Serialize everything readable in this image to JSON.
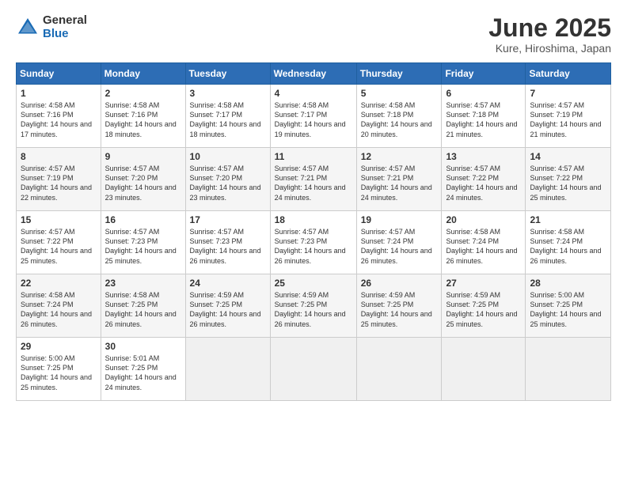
{
  "logo": {
    "general": "General",
    "blue": "Blue"
  },
  "title": "June 2025",
  "location": "Kure, Hiroshima, Japan",
  "days": [
    "Sunday",
    "Monday",
    "Tuesday",
    "Wednesday",
    "Thursday",
    "Friday",
    "Saturday"
  ],
  "weeks": [
    [
      {
        "day": "1",
        "sunrise": "4:58 AM",
        "sunset": "7:16 PM",
        "daylight": "14 hours and 17 minutes."
      },
      {
        "day": "2",
        "sunrise": "4:58 AM",
        "sunset": "7:16 PM",
        "daylight": "14 hours and 18 minutes."
      },
      {
        "day": "3",
        "sunrise": "4:58 AM",
        "sunset": "7:17 PM",
        "daylight": "14 hours and 18 minutes."
      },
      {
        "day": "4",
        "sunrise": "4:58 AM",
        "sunset": "7:17 PM",
        "daylight": "14 hours and 19 minutes."
      },
      {
        "day": "5",
        "sunrise": "4:58 AM",
        "sunset": "7:18 PM",
        "daylight": "14 hours and 20 minutes."
      },
      {
        "day": "6",
        "sunrise": "4:57 AM",
        "sunset": "7:18 PM",
        "daylight": "14 hours and 21 minutes."
      },
      {
        "day": "7",
        "sunrise": "4:57 AM",
        "sunset": "7:19 PM",
        "daylight": "14 hours and 21 minutes."
      }
    ],
    [
      {
        "day": "8",
        "sunrise": "4:57 AM",
        "sunset": "7:19 PM",
        "daylight": "14 hours and 22 minutes."
      },
      {
        "day": "9",
        "sunrise": "4:57 AM",
        "sunset": "7:20 PM",
        "daylight": "14 hours and 23 minutes."
      },
      {
        "day": "10",
        "sunrise": "4:57 AM",
        "sunset": "7:20 PM",
        "daylight": "14 hours and 23 minutes."
      },
      {
        "day": "11",
        "sunrise": "4:57 AM",
        "sunset": "7:21 PM",
        "daylight": "14 hours and 24 minutes."
      },
      {
        "day": "12",
        "sunrise": "4:57 AM",
        "sunset": "7:21 PM",
        "daylight": "14 hours and 24 minutes."
      },
      {
        "day": "13",
        "sunrise": "4:57 AM",
        "sunset": "7:22 PM",
        "daylight": "14 hours and 24 minutes."
      },
      {
        "day": "14",
        "sunrise": "4:57 AM",
        "sunset": "7:22 PM",
        "daylight": "14 hours and 25 minutes."
      }
    ],
    [
      {
        "day": "15",
        "sunrise": "4:57 AM",
        "sunset": "7:22 PM",
        "daylight": "14 hours and 25 minutes."
      },
      {
        "day": "16",
        "sunrise": "4:57 AM",
        "sunset": "7:23 PM",
        "daylight": "14 hours and 25 minutes."
      },
      {
        "day": "17",
        "sunrise": "4:57 AM",
        "sunset": "7:23 PM",
        "daylight": "14 hours and 26 minutes."
      },
      {
        "day": "18",
        "sunrise": "4:57 AM",
        "sunset": "7:23 PM",
        "daylight": "14 hours and 26 minutes."
      },
      {
        "day": "19",
        "sunrise": "4:57 AM",
        "sunset": "7:24 PM",
        "daylight": "14 hours and 26 minutes."
      },
      {
        "day": "20",
        "sunrise": "4:58 AM",
        "sunset": "7:24 PM",
        "daylight": "14 hours and 26 minutes."
      },
      {
        "day": "21",
        "sunrise": "4:58 AM",
        "sunset": "7:24 PM",
        "daylight": "14 hours and 26 minutes."
      }
    ],
    [
      {
        "day": "22",
        "sunrise": "4:58 AM",
        "sunset": "7:24 PM",
        "daylight": "14 hours and 26 minutes."
      },
      {
        "day": "23",
        "sunrise": "4:58 AM",
        "sunset": "7:25 PM",
        "daylight": "14 hours and 26 minutes."
      },
      {
        "day": "24",
        "sunrise": "4:59 AM",
        "sunset": "7:25 PM",
        "daylight": "14 hours and 26 minutes."
      },
      {
        "day": "25",
        "sunrise": "4:59 AM",
        "sunset": "7:25 PM",
        "daylight": "14 hours and 26 minutes."
      },
      {
        "day": "26",
        "sunrise": "4:59 AM",
        "sunset": "7:25 PM",
        "daylight": "14 hours and 25 minutes."
      },
      {
        "day": "27",
        "sunrise": "4:59 AM",
        "sunset": "7:25 PM",
        "daylight": "14 hours and 25 minutes."
      },
      {
        "day": "28",
        "sunrise": "5:00 AM",
        "sunset": "7:25 PM",
        "daylight": "14 hours and 25 minutes."
      }
    ],
    [
      {
        "day": "29",
        "sunrise": "5:00 AM",
        "sunset": "7:25 PM",
        "daylight": "14 hours and 25 minutes."
      },
      {
        "day": "30",
        "sunrise": "5:01 AM",
        "sunset": "7:25 PM",
        "daylight": "14 hours and 24 minutes."
      },
      null,
      null,
      null,
      null,
      null
    ]
  ]
}
